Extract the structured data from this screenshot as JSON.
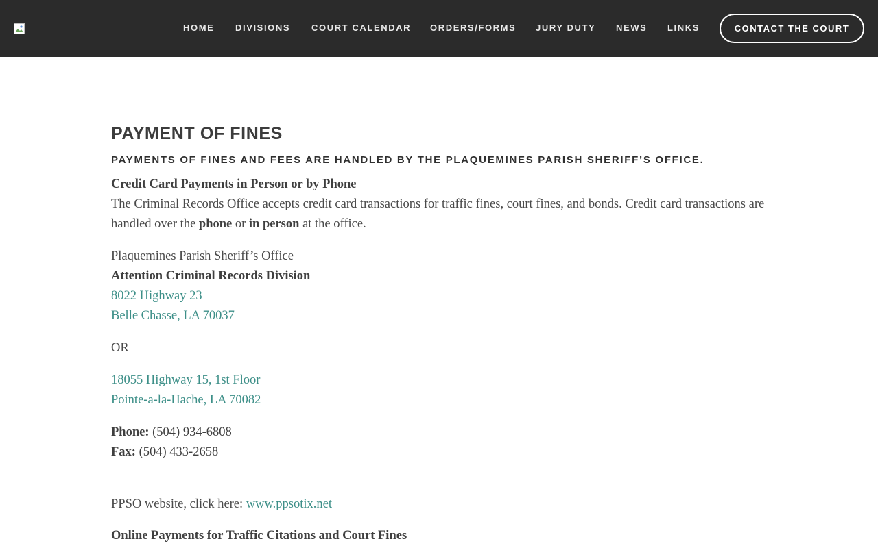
{
  "header": {
    "nav": [
      {
        "label": "HOME"
      },
      {
        "label": "DIVISIONS"
      },
      {
        "label": "COURT CALENDAR"
      },
      {
        "label": "ORDERS/FORMS"
      },
      {
        "label": "JURY DUTY"
      },
      {
        "label": "NEWS"
      },
      {
        "label": "LINKS"
      }
    ],
    "contact_button": "CONTACT THE COURT"
  },
  "main": {
    "title": "PAYMENT OF FINES",
    "subtitle": "PAYMENTS OF FINES AND FEES ARE HANDLED BY THE PLAQUEMINES PARISH SHERIFF’S OFFICE.",
    "credit_heading": "Credit Card Payments in Person or by Phone",
    "credit_text_1": "The Criminal Records Office accepts credit card transactions for traffic fines, court fines, and bonds. Credit card transactions are handled over the ",
    "credit_phone": "phone",
    "credit_or": " or ",
    "credit_in_person": "in person",
    "credit_text_2": " at the office.",
    "office_name": "Plaquemines Parish Sheriff’s Office",
    "attention": "Attention Criminal Records Division",
    "address1_line1": "8022 Highway 23",
    "address1_line2": "Belle Chasse, LA 70037",
    "or_text": "OR",
    "address2_line1": "18055 Highway 15, 1st Floor",
    "address2_line2": "Pointe-a-la-Hache, LA 70082",
    "phone_label": "Phone:",
    "phone_value": " (504) 934-6808",
    "fax_label": "Fax:",
    "fax_value": " (504) 433-2658",
    "website_text": "PPSO website, click here: ",
    "website_link": "www.ppsotix.net",
    "online_heading": "Online Payments for Traffic Citations and Court Fines"
  },
  "colors": {
    "header_bg": "#2b2b2b",
    "link": "#3d8f88",
    "text": "#4a4a4a"
  }
}
